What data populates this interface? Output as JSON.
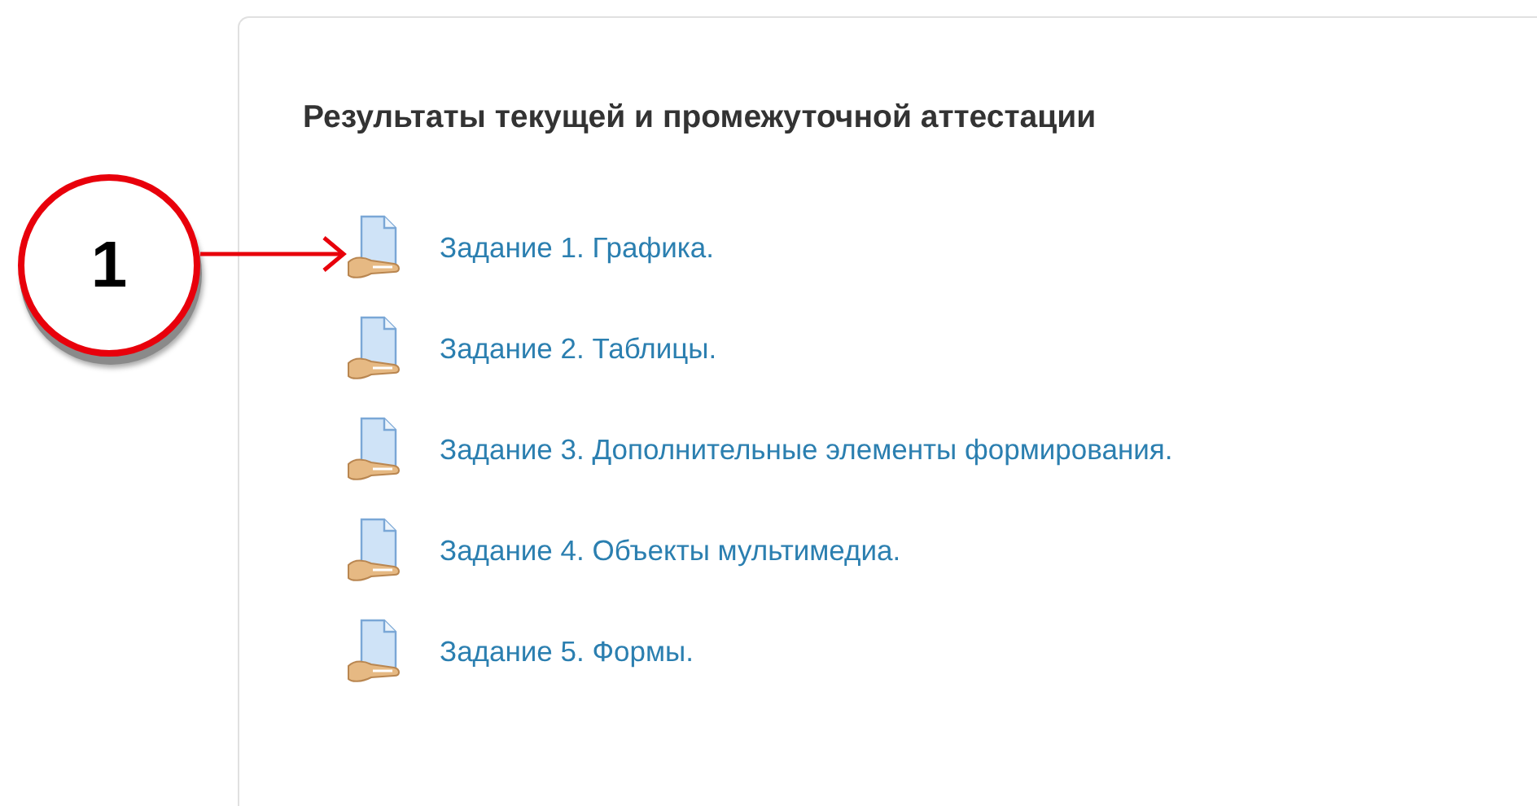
{
  "callout": {
    "label": "1"
  },
  "section": {
    "heading": "Результаты текущей и промежуточной аттестации",
    "activities": [
      {
        "title": "Задание 1. Графика."
      },
      {
        "title": "Задание 2. Таблицы."
      },
      {
        "title": "Задание 3. Дополнительные элементы формирования."
      },
      {
        "title": "Задание 4. Объекты мультимедиа."
      },
      {
        "title": "Задание 5. Формы."
      }
    ]
  }
}
